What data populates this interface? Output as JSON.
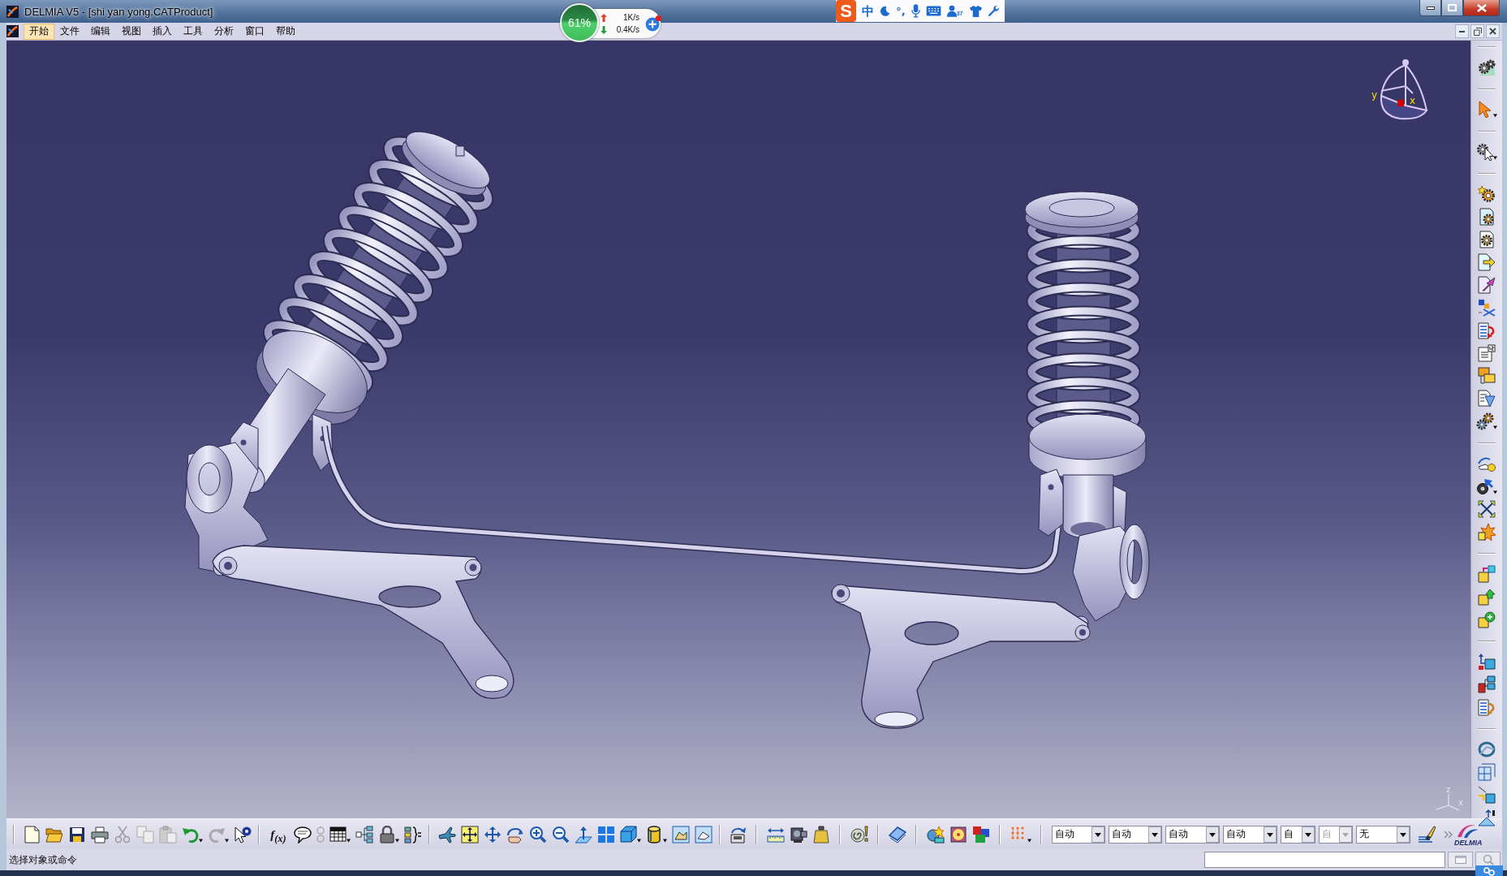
{
  "window": {
    "title": "DELMIA V5 - [shi yan yong.CATProduct]"
  },
  "menu": [
    {
      "label": "开始",
      "selected": true
    },
    {
      "label": "文件",
      "selected": false
    },
    {
      "label": "编辑",
      "selected": false
    },
    {
      "label": "视图",
      "selected": false
    },
    {
      "label": "插入",
      "selected": false
    },
    {
      "label": "工具",
      "selected": false
    },
    {
      "label": "分析",
      "selected": false
    },
    {
      "label": "窗口",
      "selected": false
    },
    {
      "label": "帮助",
      "selected": false
    }
  ],
  "network_monitor": {
    "usage": "61%",
    "upload": "1K/s",
    "download": "0.4K/s"
  },
  "ime_bar": {
    "logo": "S",
    "mode": "中",
    "punctuation": "°,",
    "badge": "37"
  },
  "viewport": {
    "compass": {
      "y_label": "y",
      "x_label": "x"
    },
    "axis_triad": {
      "z_label": "z",
      "x_label": "x"
    }
  },
  "bottom_toolbar": {
    "formula_label": "f$_{(x)}$",
    "dropdowns": [
      {
        "value": "自动",
        "disabled": false
      },
      {
        "value": "自动",
        "disabled": false
      },
      {
        "value": "自动",
        "disabled": false
      },
      {
        "value": "自动",
        "disabled": false
      },
      {
        "value": "自",
        "disabled": false
      },
      {
        "value": "自",
        "disabled": true
      },
      {
        "value": "无",
        "disabled": false
      }
    ],
    "logo_text": "DELMIA"
  },
  "status_bar": {
    "message": "选择对象或命令"
  }
}
